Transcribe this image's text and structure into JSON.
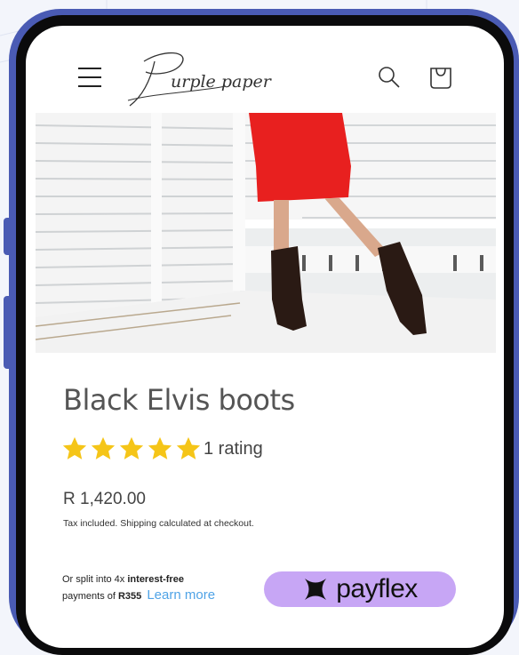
{
  "header": {
    "menu_icon": "hamburger-icon",
    "logo_text": "Purple paper",
    "search_icon": "search-icon",
    "cart_icon": "cart-icon"
  },
  "product": {
    "title": "Black Elvis boots",
    "rating_stars": 5,
    "rating_text": "1 rating",
    "price": "R 1,420.00",
    "tax_note": "Tax included. Shipping calculated at checkout."
  },
  "payment": {
    "split_prefix": "Or split into 4x",
    "split_bold": "interest-free",
    "payments_of": "payments of",
    "installment": "R355",
    "learn_more": "Learn more",
    "provider": "payflex"
  },
  "colors": {
    "phone_frame": "#4a5bb4",
    "star": "#f5c518",
    "payflex_bg": "#c7a6f5",
    "link": "#4fa3e6"
  }
}
